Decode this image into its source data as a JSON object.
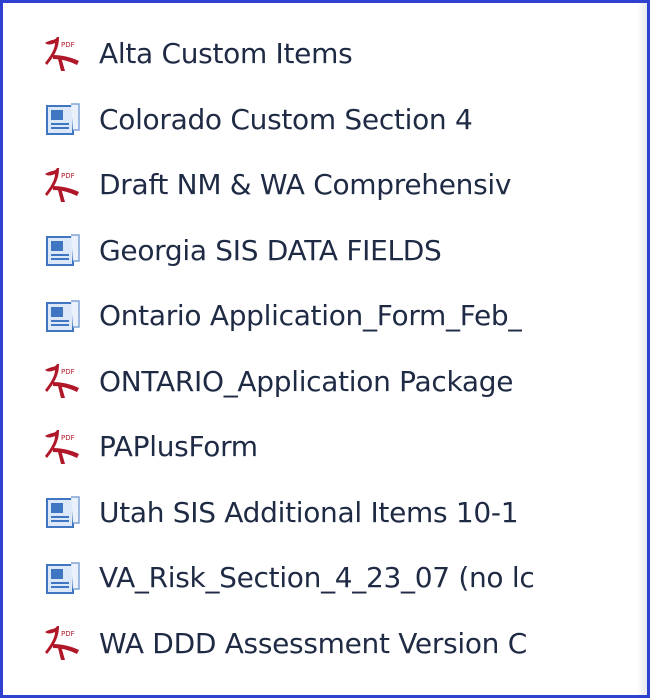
{
  "files": [
    {
      "name": "Alta Custom Items",
      "icon": "pdf-icon"
    },
    {
      "name": "Colorado Custom Section 4",
      "icon": "word-doc-icon"
    },
    {
      "name": "Draft NM & WA Comprehensiv",
      "icon": "pdf-icon"
    },
    {
      "name": "Georgia SIS DATA FIELDS",
      "icon": "word-doc-icon"
    },
    {
      "name": "Ontario Application_Form_Feb_",
      "icon": "word-doc-icon"
    },
    {
      "name": "ONTARIO_Application Package",
      "icon": "pdf-icon"
    },
    {
      "name": "PAPlusForm",
      "icon": "pdf-icon"
    },
    {
      "name": "Utah SIS Additional Items 10-1",
      "icon": "word-doc-icon"
    },
    {
      "name": "VA_Risk_Section_4_23_07 (no lc",
      "icon": "word-doc-icon"
    },
    {
      "name": "WA DDD Assessment Version C",
      "icon": "pdf-icon"
    }
  ],
  "colors": {
    "border": "#2f3fd0",
    "pdf": "#b0182a",
    "doc": "#3f76c2",
    "text": "#1f2a44"
  }
}
